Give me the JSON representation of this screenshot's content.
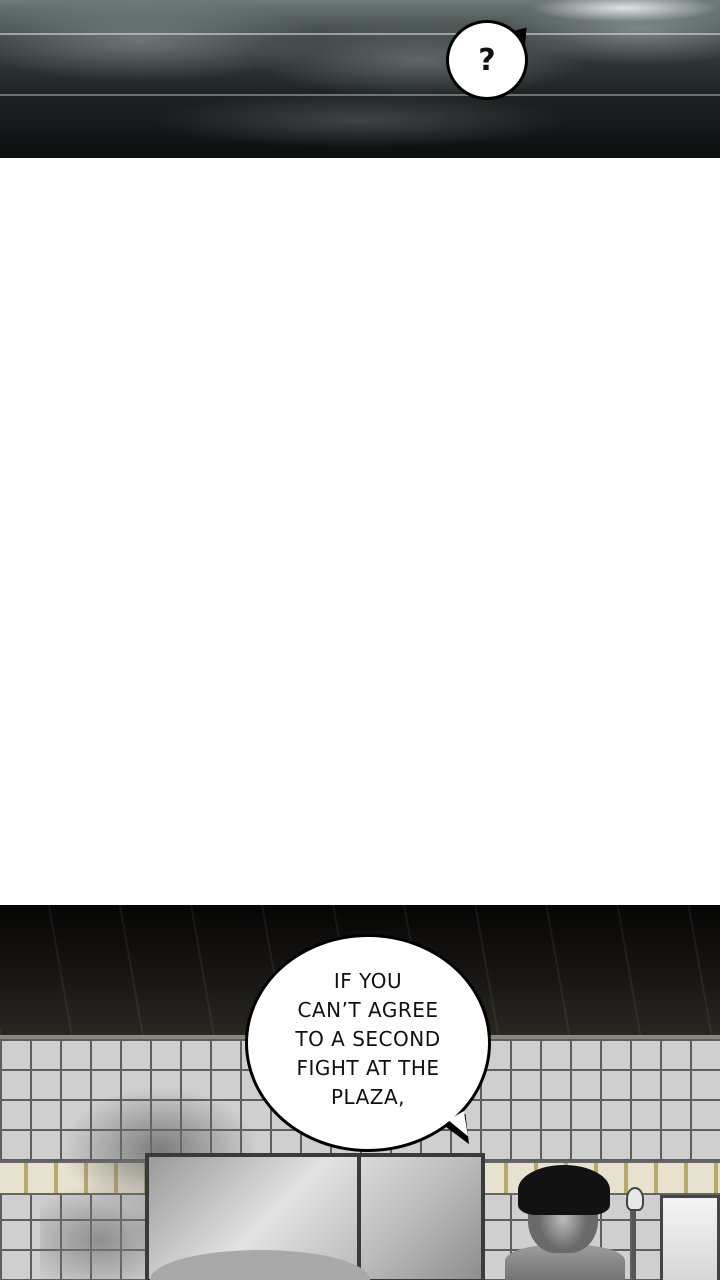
{
  "panels": {
    "top": {
      "bubble_text": "?"
    },
    "bottom": {
      "bubble_lines": [
        "IF YOU",
        "CAN’T AGREE",
        "TO A SECOND",
        "FIGHT AT THE",
        "PLAZA,"
      ]
    }
  },
  "colors": {
    "background": "#ffffff",
    "panel_dark": "#0d0f0f",
    "bubble_fill": "#ffffff",
    "bubble_outline": "#000000",
    "tile": "#cfcfcf"
  }
}
